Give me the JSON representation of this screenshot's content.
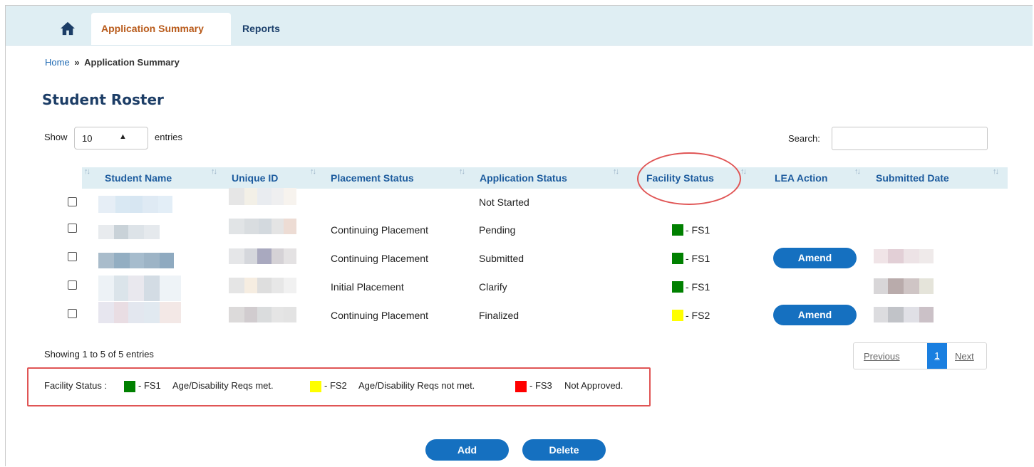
{
  "nav": {
    "tabs": [
      {
        "label": "Application Summary",
        "active": true
      },
      {
        "label": "Reports",
        "active": false
      }
    ]
  },
  "breadcrumb": {
    "home": "Home",
    "separator": "»",
    "current": "Application Summary"
  },
  "page_title": "Student Roster",
  "length_menu": {
    "show_label": "Show",
    "value": "10",
    "entries_label": "entries"
  },
  "search": {
    "label": "Search:",
    "value": ""
  },
  "table": {
    "columns": [
      "Student Name",
      "Unique ID",
      "Placement Status",
      "Application Status",
      "Facility Status",
      "LEA Action",
      "Submitted Date"
    ],
    "rows": [
      {
        "placement": "",
        "application": "Not Started",
        "facility": "",
        "lea_action": ""
      },
      {
        "placement": "Continuing Placement",
        "application": "Pending",
        "facility": "- FS1",
        "lea_action": ""
      },
      {
        "placement": "Continuing Placement",
        "application": "Submitted",
        "facility": "- FS1",
        "lea_action": "Amend"
      },
      {
        "placement": "Initial Placement",
        "application": "Clarify",
        "facility": "- FS1",
        "lea_action": ""
      },
      {
        "placement": "Continuing Placement",
        "application": "Finalized",
        "facility": "- FS2",
        "lea_action": "Amend"
      }
    ]
  },
  "info": "Showing 1 to 5 of 5 entries",
  "pagination": {
    "previous": "Previous",
    "current": "1",
    "next": "Next"
  },
  "legend": {
    "label": "Facility Status :",
    "items": [
      {
        "code": "- FS1",
        "text": "Age/Disability Reqs met.",
        "color": "#008000"
      },
      {
        "code": "- FS2",
        "text": "Age/Disability Reqs not met.",
        "color": "#ffff00"
      },
      {
        "code": "- FS3",
        "text": "Not Approved.",
        "color": "#ff0000"
      }
    ]
  },
  "actions": {
    "add": "Add",
    "delete": "Delete"
  },
  "colors": {
    "accent": "#1570c0",
    "header_bg": "#dfeef3",
    "highlight": "#e05555",
    "tab_active": "#b85a1a"
  }
}
